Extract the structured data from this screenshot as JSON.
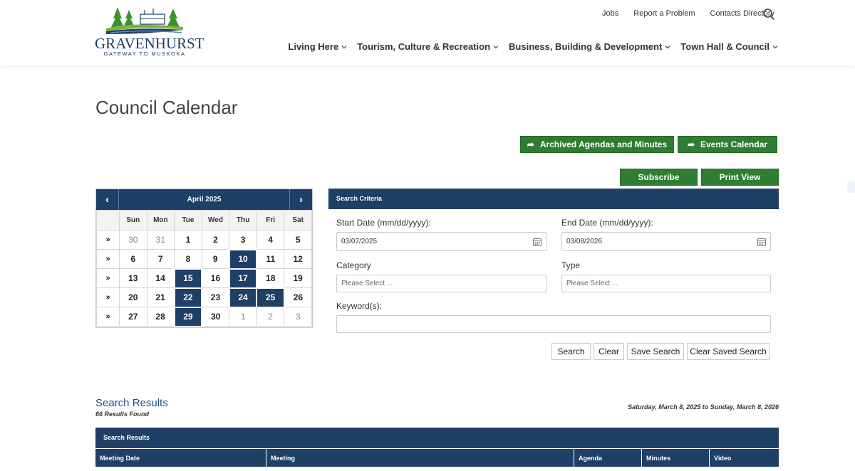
{
  "logo": {
    "wordmark": "GRAVENHURST",
    "tagline": "GATEWAY TO MUSKOKA"
  },
  "utility_nav": [
    "Jobs",
    "Report a Problem",
    "Contacts Directory"
  ],
  "main_nav": [
    "Living Here",
    "Tourism, Culture & Recreation",
    "Business, Building & Development",
    "Town Hall & Council"
  ],
  "page_title": "Council Calendar",
  "buttons": {
    "archived": "Archived Agendas and Minutes",
    "events": "Events Calendar",
    "subscribe": "Subscribe",
    "print": "Print View"
  },
  "calendar": {
    "month": "April 2025",
    "prev": "‹",
    "next": "›",
    "week_marker": "»",
    "days": [
      "Sun",
      "Mon",
      "Tue",
      "Wed",
      "Thu",
      "Fri",
      "Sat"
    ],
    "weeks": [
      [
        "30",
        "31",
        "1",
        "2",
        "3",
        "4",
        "5"
      ],
      [
        "6",
        "7",
        "8",
        "9",
        "10",
        "11",
        "12"
      ],
      [
        "13",
        "14",
        "15",
        "16",
        "17",
        "18",
        "19"
      ],
      [
        "20",
        "21",
        "22",
        "23",
        "24",
        "25",
        "26"
      ],
      [
        "27",
        "28",
        "29",
        "30",
        "1",
        "2",
        "3"
      ]
    ]
  },
  "criteria": {
    "title": "Search Criteria",
    "start_label": "Start Date (mm/dd/yyyy):",
    "start_value": "03/07/2025",
    "end_label": "End Date (mm/dd/yyyy):",
    "end_value": "03/08/2026",
    "category_label": "Category",
    "category_placeholder": "Please Select ...",
    "type_label": "Type",
    "type_placeholder": "Please Select ...",
    "keyword_label": "Keyword(s):",
    "keyword_value": "",
    "search_btn": "Search",
    "clear_btn": "Clear",
    "save_btn": "Save Search",
    "clear_saved_btn": "Clear Saved Search"
  },
  "results": {
    "title": "Search Results",
    "count": "66 Results Found",
    "range": "Saturday, March 8, 2025 to Sunday, March 8, 2026",
    "panel_title": "Search Results",
    "columns": [
      "Meeting Date",
      "Meeting",
      "Agenda",
      "Minutes",
      "Video"
    ]
  },
  "colors": {
    "navy": "#1e3f66",
    "green": "#2e7d32",
    "link": "#1e4f85"
  }
}
